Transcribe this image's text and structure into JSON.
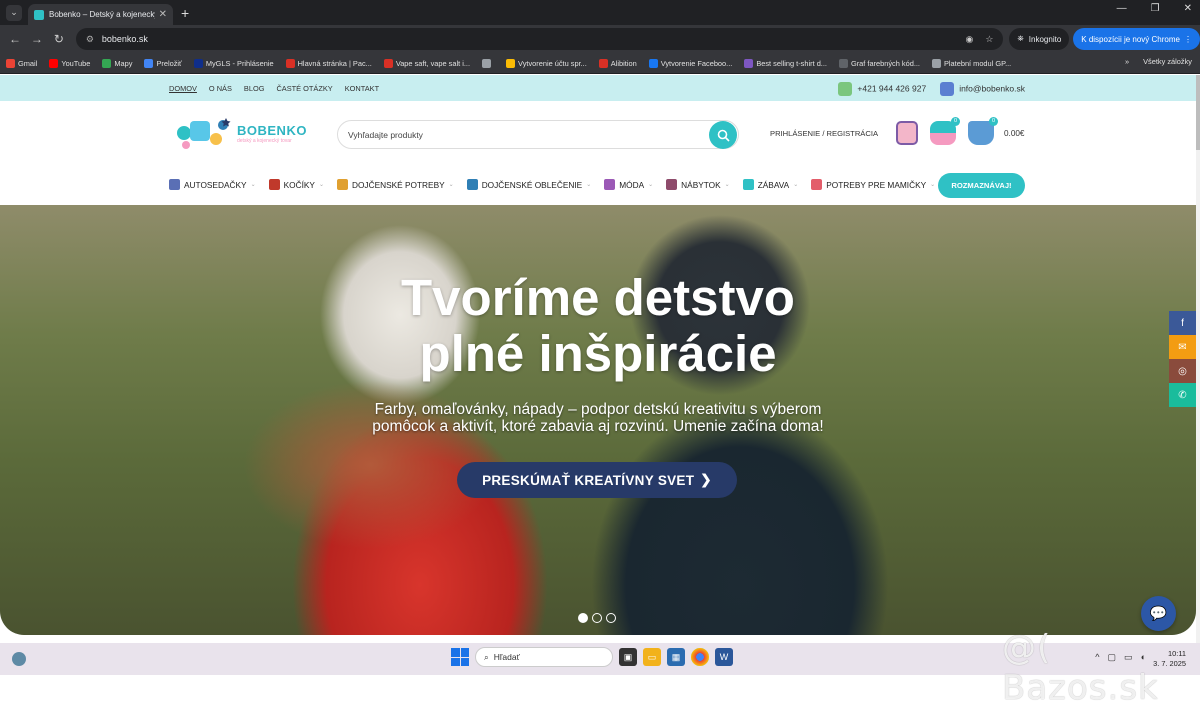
{
  "browser": {
    "tab_title": "Bobenko – Detský a kojenecký",
    "url": "bobenko.sk",
    "incognito_label": "Inkognito",
    "update_label": "K dispozícii je nový Chrome",
    "bookmarks": [
      {
        "label": "Gmail",
        "color": "#ea4335"
      },
      {
        "label": "YouTube",
        "color": "#ff0000"
      },
      {
        "label": "Mapy",
        "color": "#34a853"
      },
      {
        "label": "Preložiť",
        "color": "#4285f4"
      },
      {
        "label": "MyGLS - Prihlásenie",
        "color": "#0f2e8a"
      },
      {
        "label": "Hlavná stránka | Pac...",
        "color": "#d93025"
      },
      {
        "label": "Vape saft, vape salt i...",
        "color": "#d93025"
      },
      {
        "label": "",
        "color": "#9aa0a6"
      },
      {
        "label": "Vytvorenie účtu spr...",
        "color": "#fbbc05"
      },
      {
        "label": "Alibition",
        "color": "#d93025"
      },
      {
        "label": "Vytvorenie Faceboo...",
        "color": "#1877f2"
      },
      {
        "label": "Best selling t-shirt d...",
        "color": "#7e57c2"
      },
      {
        "label": "Graf farebných kód...",
        "color": "#5f6368"
      },
      {
        "label": "Platební modul GP...",
        "color": "#9aa0a6"
      }
    ],
    "all_bookmarks_label": "Všetky záložky"
  },
  "topbar": {
    "links": [
      "DOMOV",
      "O NÁS",
      "BLOG",
      "ČASTÉ OTÁZKY",
      "KONTAKT"
    ],
    "phone": "+421 944 426 927",
    "email": "info@bobenko.sk"
  },
  "header": {
    "logo_text": "BOBENKO",
    "logo_sub": "detský a kojenecký tovar",
    "search_placeholder": "Vyhľadajte produkty",
    "login_label": "PRIHLÁSENIE / REGISTRÁCIA",
    "wishlist_count": "0",
    "cart_count": "0",
    "cart_total": "0.00€"
  },
  "menu": {
    "items": [
      {
        "label": "AUTOSEDAČKY",
        "color": "#5a6fb5"
      },
      {
        "label": "KOČÍKY",
        "color": "#c0392b"
      },
      {
        "label": "DOJČENSKÉ POTREBY",
        "color": "#e0a030"
      },
      {
        "label": "DOJČENSKÉ OBLEČENIE",
        "color": "#2f7fb5"
      },
      {
        "label": "MÓDA",
        "color": "#9b59b6"
      },
      {
        "label": "NÁBYTOK",
        "color": "#8e4b6b"
      },
      {
        "label": "ZÁBAVA",
        "color": "#2fc1c5"
      },
      {
        "label": "POTREBY PRE MAMIČKY",
        "color": "#e35d6a"
      }
    ],
    "cta": "ROZMAZNÁVAJ!"
  },
  "hero": {
    "title_line1": "Tvoríme detstvo",
    "title_line2": "plné inšpirácie",
    "sub_line1": "Farby, omaľovánky, nápady – podpor detskú kreativitu s výberom",
    "sub_line2": "pomôcok a aktivít, ktoré zabavia aj rozvinú. Umenie začína doma!",
    "button": "PRESKÚMAŤ KREATÍVNY SVET",
    "slides": 3,
    "active_slide": 1
  },
  "social": [
    {
      "name": "facebook-icon",
      "color": "#3b5998",
      "glyph": "f"
    },
    {
      "name": "email-icon",
      "color": "#f39c12",
      "glyph": "✉"
    },
    {
      "name": "instagram-icon",
      "color": "#8a4b3c",
      "glyph": "◎"
    },
    {
      "name": "whatsapp-icon",
      "color": "#1abc9c",
      "glyph": "✆"
    }
  ],
  "taskbar": {
    "search_label": "Hľadať",
    "time": "10:11",
    "date": "3. 7. 2025"
  },
  "watermark": "@( Bazos.sk"
}
